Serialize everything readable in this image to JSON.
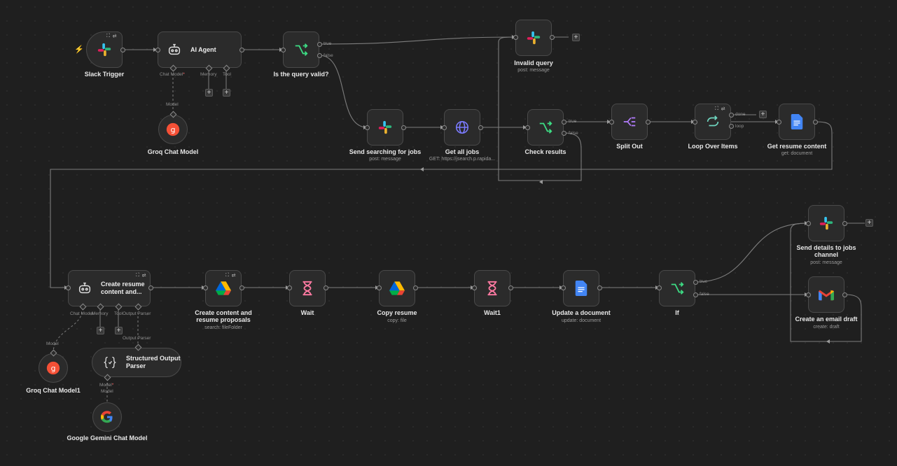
{
  "canvas": {
    "background": "#1f1f1f"
  },
  "trigger_icon": "lightning-icon",
  "nodes": {
    "slack_trigger": {
      "label": "Slack Trigger",
      "icon": "slack-icon"
    },
    "ai_agent": {
      "label": "AI Agent",
      "icon": "robot-icon",
      "ports": {
        "chat_model": "Chat Model",
        "memory": "Memory",
        "tool": "Tool"
      }
    },
    "groq_chat_model": {
      "label": "Groq Chat Model",
      "icon": "groq-icon",
      "port": "Model"
    },
    "is_query_valid": {
      "label": "Is the query valid?",
      "icon": "branch-icon",
      "true": "true",
      "false": "false"
    },
    "invalid_query": {
      "label": "Invalid query",
      "sub": "post: message",
      "icon": "slack-icon"
    },
    "send_searching": {
      "label": "Send searching for jobs",
      "sub": "post: message",
      "icon": "slack-icon"
    },
    "get_all_jobs": {
      "label": "Get all jobs",
      "sub": "GET: https://jsearch.p.rapida...",
      "icon": "globe-icon"
    },
    "check_results": {
      "label": "Check results",
      "icon": "branch-icon",
      "true": "true",
      "false": "false"
    },
    "split_out": {
      "label": "Split Out",
      "icon": "split-icon"
    },
    "loop_over_items": {
      "label": "Loop Over Items",
      "icon": "loop-icon",
      "done": "done",
      "loop": "loop"
    },
    "get_resume_content": {
      "label": "Get resume content",
      "sub": "get: document",
      "icon": "google-docs-icon"
    },
    "create_resume_content": {
      "label": "Create resume content and...",
      "icon": "robot-icon",
      "ports": {
        "chat_model": "Chat Model",
        "memory": "Memory",
        "tool": "Tool",
        "output_parser": "Output Parser"
      }
    },
    "groq_chat_model1": {
      "label": "Groq Chat Model1",
      "icon": "groq-icon",
      "port": "Model"
    },
    "structured_output_parser": {
      "label": "Structured Output Parser",
      "icon": "braces-icon",
      "port_top": "Output Parser",
      "port_bottom": "Model",
      "port_bottom2": "Model"
    },
    "google_gemini": {
      "label": "Google Gemini Chat Model",
      "icon": "google-icon"
    },
    "create_content_proposals": {
      "label": "Create content and resume proposals",
      "sub": "search: fileFolder",
      "icon": "google-drive-icon"
    },
    "wait": {
      "label": "Wait",
      "icon": "hourglass-icon"
    },
    "copy_resume": {
      "label": "Copy resume",
      "sub": "copy: file",
      "icon": "google-drive-icon"
    },
    "wait1": {
      "label": "Wait1",
      "icon": "hourglass-icon"
    },
    "update_document": {
      "label": "Update a document",
      "sub": "update: document",
      "icon": "google-docs-icon"
    },
    "if_node": {
      "label": "If",
      "icon": "branch-icon",
      "true": "true",
      "false": "false"
    },
    "send_details": {
      "label": "Send details to jobs channel",
      "sub": "post: message",
      "icon": "slack-icon"
    },
    "create_email_draft": {
      "label": "Create an email draft",
      "sub": "create: draft",
      "icon": "gmail-icon"
    }
  },
  "add_button": "+",
  "colors": {
    "wire": "#7d7d7d",
    "node_bg": "#2b2b2b",
    "node_border": "#4a4a4a",
    "branch": "#3ddc84",
    "accent": "#ff6d3a"
  }
}
